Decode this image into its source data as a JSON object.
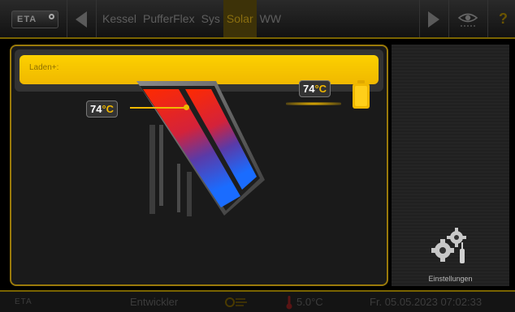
{
  "brand": {
    "logo_text": "ETA"
  },
  "nav": {
    "tabs": [
      {
        "label": "Kessel",
        "active": false
      },
      {
        "label": "PufferFlex",
        "active": false
      },
      {
        "label": "Sys",
        "active": false
      },
      {
        "label": "Solar",
        "active": true
      },
      {
        "label": "WW",
        "active": false
      }
    ],
    "help_label": "?"
  },
  "main": {
    "status_banner": "Laden+:",
    "collector_temp_value": "74",
    "collector_temp_unit": "°C",
    "storage_temp_value": "74",
    "storage_temp_unit": "°C"
  },
  "side": {
    "settings_label": "Einstellungen"
  },
  "status": {
    "logo_text": "ETA",
    "user": "Entwickler",
    "outside_temp": "5.0°C",
    "datetime": "Fr. 05.05.2023 07:02:33"
  },
  "colors": {
    "accent": "#f0b800",
    "banner": "#fcd000",
    "background": "#1a1a1a"
  }
}
